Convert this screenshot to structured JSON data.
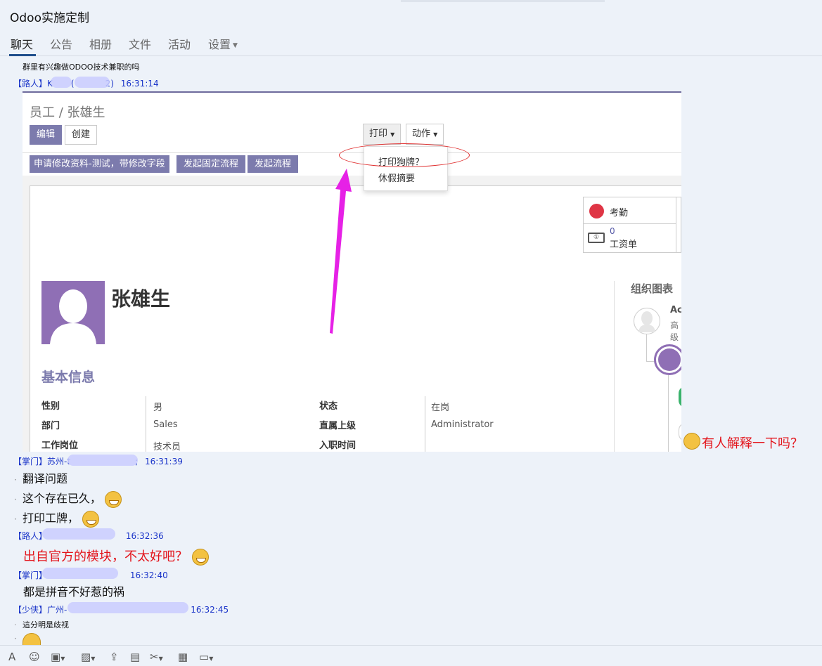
{
  "window": {
    "title": "Odoo实施定制"
  },
  "tabs": [
    {
      "label": "聊天",
      "active": true
    },
    {
      "label": "公告"
    },
    {
      "label": "相册"
    },
    {
      "label": "文件"
    },
    {
      "label": "活动"
    },
    {
      "label": "设置"
    }
  ],
  "messages": {
    "m0": {
      "text": "群里有兴趣做ODOO技术兼职的吗"
    },
    "m1": {
      "rank": "【路人】",
      "name_start": "K",
      "name_mid": "(",
      "name_end": "2)",
      "time": "16:31:14"
    },
    "annotation": {
      "text": "有人解释一下吗？"
    },
    "m2": {
      "rank": "【掌门】",
      "name_start": "苏州-t",
      "name_end": ";",
      "time": "16:31:39",
      "lines": [
        "翻译问题",
        "这个存在已久，",
        "打印工牌，"
      ]
    },
    "m3": {
      "rank": "【路人】",
      "time": "16:32:36",
      "text": "出自官方的模块，不太好吧？"
    },
    "m4": {
      "rank": "【掌门】",
      "time": "16:32:40",
      "text": "都是拼音不好惹的祸"
    },
    "m5": {
      "rank": "【少侠】",
      "name_start": "广州-",
      "time": "16:32:45",
      "text": "這分明是歧视"
    }
  },
  "screenshot": {
    "breadcrumb": "员工 / 张雄生",
    "edit_button": "编辑",
    "create_button": "创建",
    "print_button": "打印",
    "action_button": "动作",
    "print_menu": [
      "打印狗牌？",
      "休假摘要"
    ],
    "workflow_buttons": [
      "申请修改资料-测试，带修改字段",
      "发起固定流程",
      "发起流程"
    ],
    "stats": {
      "attendance_label": "考勤",
      "payslip_count": "0",
      "payslip_label": "工资单"
    },
    "employee_name": "张雄生",
    "section_title": "基本信息",
    "fields_left": [
      {
        "label": "性别",
        "value": "男"
      },
      {
        "label": "部门",
        "value": "Sales"
      },
      {
        "label": "工作岗位",
        "value": "技术员"
      }
    ],
    "fields_right": [
      {
        "label": "状态",
        "value": "在岗"
      },
      {
        "label": "直属上级",
        "value": "Administrator"
      },
      {
        "label": "入职时间",
        "value": ""
      }
    ],
    "org_chart": {
      "title": "组织图表",
      "name_fragment": "Ac",
      "title_fragment": "高级"
    }
  },
  "toolbar": {
    "icons": [
      "font-icon",
      "emoji-icon",
      "gift-card-icon",
      "image-icon",
      "upload-icon",
      "gift-icon",
      "scissors-icon",
      "record-icon",
      "chat-history-icon"
    ]
  },
  "colors": {
    "accent": "#7c7bad",
    "sender_blue": "#1b35c9",
    "alert_red": "#e3141b",
    "arrow": "#e621e6"
  }
}
